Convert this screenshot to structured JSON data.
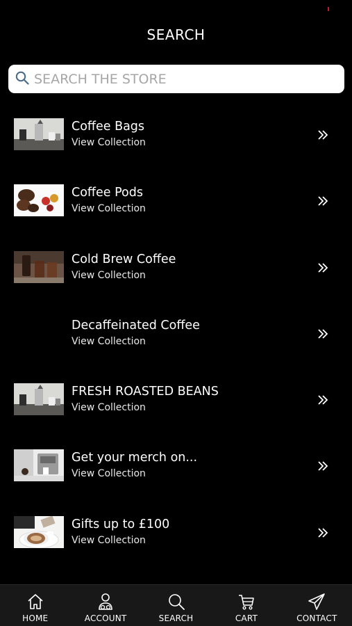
{
  "header": {
    "title": "SEARCH"
  },
  "search": {
    "placeholder": "SEARCH THE STORE",
    "icon": "search-icon"
  },
  "collections": [
    {
      "title": "Coffee Bags",
      "subtitle": "View Collection",
      "thumbnail": "coffee-equipment-image"
    },
    {
      "title": "Coffee Pods",
      "subtitle": "View Collection",
      "thumbnail": "coffee-pods-image"
    },
    {
      "title": "Cold Brew Coffee",
      "subtitle": "View Collection",
      "thumbnail": "cold-brew-image"
    },
    {
      "title": "Decaffeinated Coffee",
      "subtitle": "View Collection",
      "thumbnail": ""
    },
    {
      "title": "FRESH ROASTED BEANS",
      "subtitle": "View Collection",
      "thumbnail": "coffee-equipment-image"
    },
    {
      "title": "Get your merch on...",
      "subtitle": "View Collection",
      "thumbnail": "espresso-machine-image"
    },
    {
      "title": "Gifts up to £100",
      "subtitle": "View Collection",
      "thumbnail": "coffee-cup-image"
    }
  ],
  "tabbar": {
    "items": [
      {
        "label": "HOME",
        "icon": "home-icon"
      },
      {
        "label": "ACCOUNT",
        "icon": "account-icon"
      },
      {
        "label": "SEARCH",
        "icon": "search-icon"
      },
      {
        "label": "CART",
        "icon": "cart-icon"
      },
      {
        "label": "CONTACT",
        "icon": "paper-plane-icon"
      }
    ]
  },
  "colors": {
    "background": "#000000",
    "tabbar": "#181818",
    "search_field": "#ffffff",
    "search_icon": "#4a6a8a",
    "status_accent": "#c0182a"
  }
}
